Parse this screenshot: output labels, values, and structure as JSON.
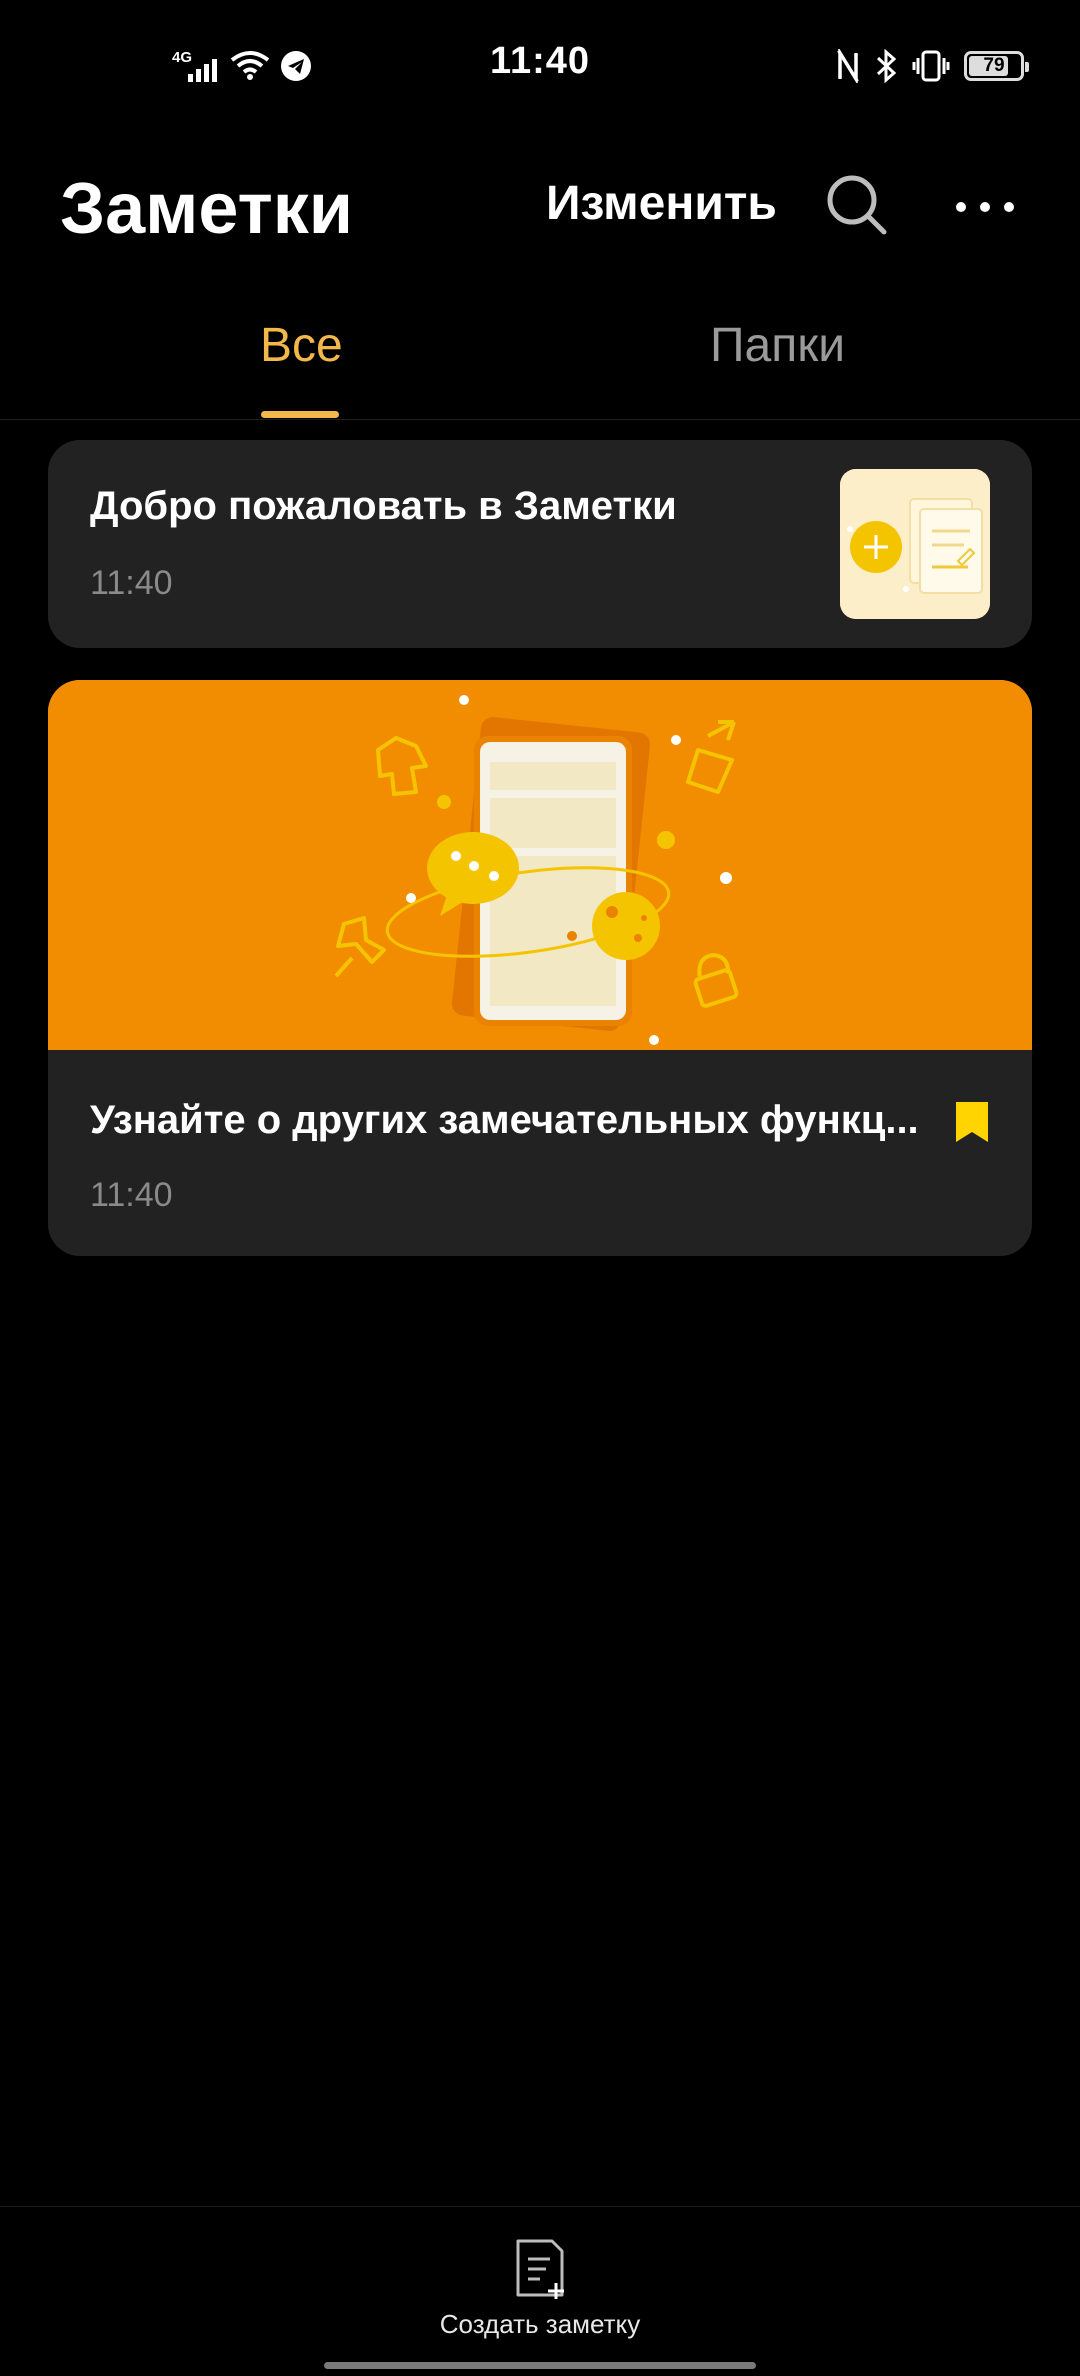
{
  "status_bar": {
    "time": "11:40",
    "network": "4G",
    "battery": "79",
    "battery_level": 0.79,
    "icons": [
      "signal-icon",
      "wifi-icon",
      "telegram-icon",
      "nfc-icon",
      "bluetooth-icon",
      "vibrate-icon",
      "battery-icon"
    ]
  },
  "header": {
    "title": "Заметки",
    "edit_label": "Изменить",
    "search_icon": "search-icon",
    "more_icon": "more-icon"
  },
  "tabs": [
    {
      "label": "Все",
      "active": true
    },
    {
      "label": "Папки",
      "active": false
    }
  ],
  "notes": [
    {
      "title": "Добро пожаловать в Заметки",
      "time": "11:40",
      "thumbnail": "welcome-thumbnail"
    },
    {
      "title": "Узнайте о других замечательных функц...",
      "time": "11:40",
      "banner": "features-banner",
      "bookmarked": true
    }
  ],
  "bottom_bar": {
    "new_note_label": "Создать заметку",
    "new_note_icon": "new-note-icon"
  },
  "colors": {
    "accent": "#f3b84a",
    "banner": "#f28c00",
    "card": "#222222",
    "bookmark": "#ffd400"
  }
}
